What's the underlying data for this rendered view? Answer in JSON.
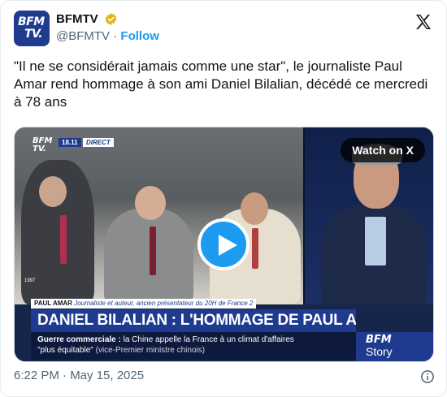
{
  "author": {
    "display_name": "BFMTV",
    "handle": "@BFMTV",
    "separator": "·",
    "follow_label": "Follow",
    "avatar_line1": "BFM",
    "avatar_line2": "TV."
  },
  "tweet": {
    "text": "\"Il ne se considérait jamais comme une star\", le journaliste Paul Amar rend hommage à son ami Daniel Bilalian, décédé ce mercredi à 78 ans"
  },
  "media": {
    "watch_label": "Watch on X",
    "channel_logo_line1": "BFM",
    "channel_logo_line2": "TV.",
    "time_badge": "18.11",
    "direct_badge": "DIRECT",
    "speaker_name": "PAUL AMAR",
    "speaker_title": "Journaliste et auteur, ancien présentateur du 20H de France 2",
    "headline": "DANIEL BILALIAN : L'HOMMAGE DE PAUL AMAR",
    "ticker_label": "Guerre commerciale :",
    "ticker_text": "la Chine appelle la France à un climat d'affaires",
    "ticker_quote": "\"plus équitable\"",
    "ticker_source": "(vice-Premier ministre chinois)",
    "story_line1": "BFM",
    "story_line2": "Story",
    "archive_year": "1997"
  },
  "footer": {
    "timestamp": "6:22 PM · May 15, 2025"
  },
  "colors": {
    "accent": "#1d9bf0",
    "brand": "#1f3b8f",
    "verified": "#e2b719"
  },
  "icons": [
    "verified-badge-icon",
    "x-logo-icon",
    "play-icon",
    "info-icon"
  ]
}
